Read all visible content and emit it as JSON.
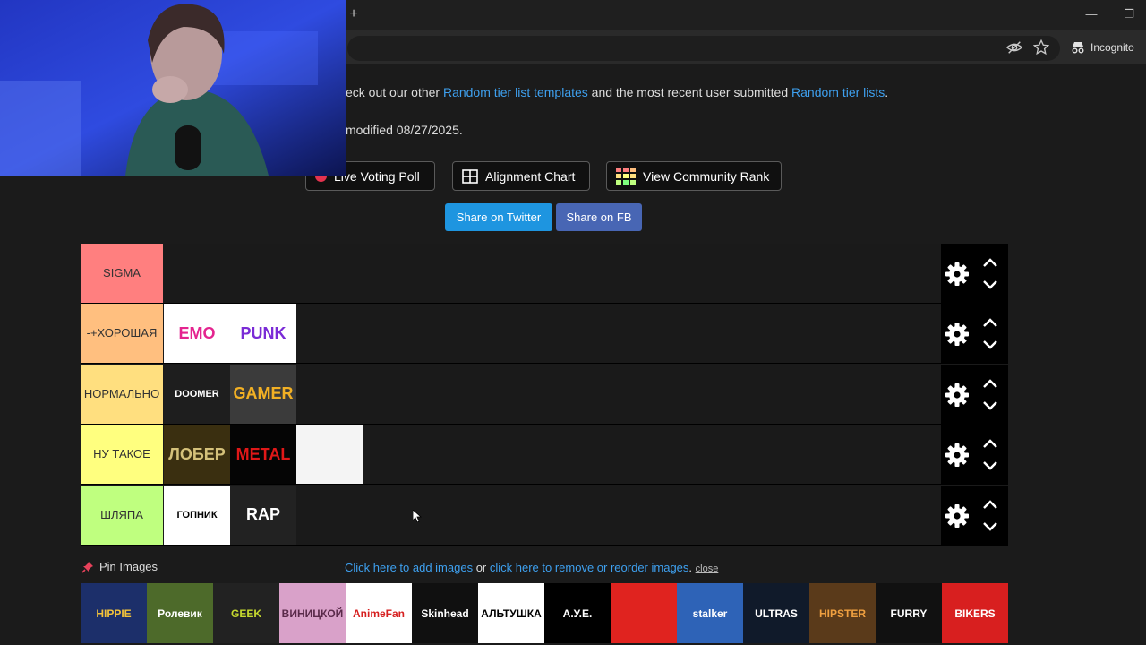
{
  "browser": {
    "new_tab_symbol": "+",
    "minimize_symbol": "—",
    "restore_symbol": "❐",
    "incognito_label": "Incognito"
  },
  "intro": {
    "prefix": "eck out our other ",
    "templates_link": "Random tier list templates",
    "middle": " and the most recent user submitted ",
    "lists_link": "Random tier lists",
    "suffix": ".",
    "modified": "modified 08/27/2025."
  },
  "actions": {
    "live_poll": "Live Voting Poll",
    "alignment": "Alignment Chart",
    "community_rank": "View Community Rank",
    "share_twitter": "Share on Twitter",
    "share_fb": "Share on FB"
  },
  "tiers": [
    {
      "label": "SIGMA",
      "color": "#ff7f7f",
      "items": []
    },
    {
      "label": "-+ХОРОШАЯ",
      "color": "#ffbf7f",
      "items": [
        {
          "text": "EMO",
          "bg": "#ffffff",
          "fg": "#e4248f"
        },
        {
          "text": "PUNK",
          "bg": "#ffffff",
          "fg": "#7a2bd6"
        }
      ]
    },
    {
      "label": "НОРМАЛЬНО",
      "color": "#ffdf7f",
      "items": [
        {
          "text": "DOOMER",
          "bg": "#1e1e1e",
          "fg": "#ffffff"
        },
        {
          "text": "GAMER",
          "bg": "#3b3b3b",
          "fg": "#f2b024"
        }
      ]
    },
    {
      "label": "НУ ТАКОЕ",
      "color": "#ffff7f",
      "items": [
        {
          "text": "ЛОБЕР",
          "bg": "#3a2f10",
          "fg": "#d4c17a"
        },
        {
          "text": "METAL",
          "bg": "#050505",
          "fg": "#e01818"
        },
        {
          "text": "",
          "bg": "#f4f4f4",
          "fg": "#2a8a2a"
        }
      ]
    },
    {
      "label": "ШЛЯПА",
      "color": "#bfff7f",
      "items": [
        {
          "text": "ГОПНИК",
          "bg": "#ffffff",
          "fg": "#000000"
        },
        {
          "text": "RAP",
          "bg": "#222222",
          "fg": "#ffffff"
        }
      ]
    }
  ],
  "pin_images_label": "Pin Images",
  "bottom": {
    "add_images": "Click here to add images",
    "or": " or ",
    "remove_images": "click here to remove or reorder images",
    "period": ". ",
    "close": "close"
  },
  "pool": [
    {
      "text": "HIPPIE",
      "bg": "#1c2f6a",
      "fg": "#f3c33a"
    },
    {
      "text": "Ролевик",
      "bg": "#4d6a2a",
      "fg": "#ffffff"
    },
    {
      "text": "GEEK",
      "bg": "#222222",
      "fg": "#c6d92f"
    },
    {
      "text": "ВИНИЦКОЙ",
      "bg": "#d9a1c9",
      "fg": "#5a2a4a"
    },
    {
      "text": "AnimeFan",
      "bg": "#ffffff",
      "fg": "#d62020"
    },
    {
      "text": "Skinhead",
      "bg": "#101010",
      "fg": "#ffffff"
    },
    {
      "text": "АЛЬТУШКА",
      "bg": "#ffffff",
      "fg": "#000000"
    },
    {
      "text": "А.У.Е.",
      "bg": "#000000",
      "fg": "#ffffff"
    },
    {
      "text": "",
      "bg": "#e0231f",
      "fg": "#ffffff"
    },
    {
      "text": "stalker",
      "bg": "#2e63b7",
      "fg": "#ffffff"
    },
    {
      "text": "ULTRAS",
      "bg": "#101a2a",
      "fg": "#ffffff"
    },
    {
      "text": "HIPSTER",
      "bg": "#5a3a1a",
      "fg": "#f0a040"
    },
    {
      "text": "FURRY",
      "bg": "#111111",
      "fg": "#ffffff"
    },
    {
      "text": "BIKERS",
      "bg": "#d81f1f",
      "fg": "#ffffff"
    }
  ]
}
